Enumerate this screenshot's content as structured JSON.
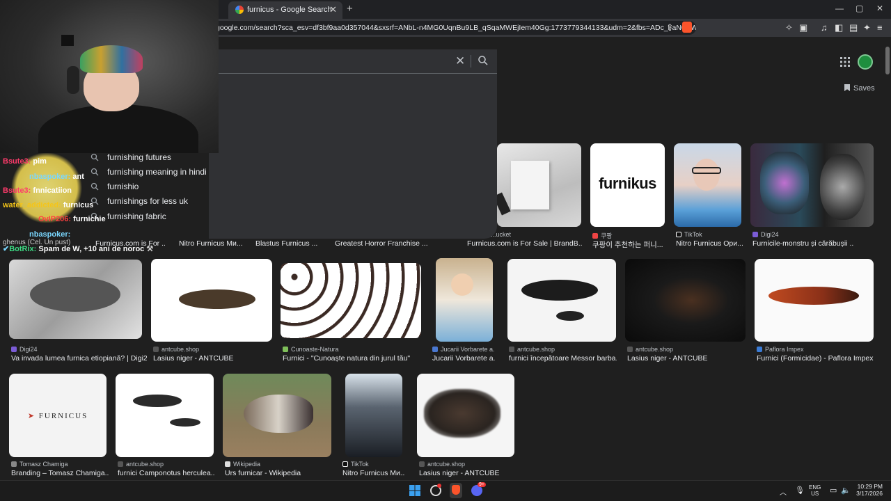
{
  "browser": {
    "tab_title": "furnicus - Google Search",
    "new_tab": "+",
    "close_tab": "✕",
    "url": "google.com/search?sca_esv=df3bf9aa0d357044&sxsrf=ANbL-n4MG0UqnBu9LB_qSqaMWEjIem40Gg:1773779344133&udm=2&fbs=ADc_l-aN0CWEZBOHj...",
    "window_controls": [
      "—",
      "▢",
      "✕"
    ]
  },
  "search": {
    "suggestions": [
      "furnishing futures",
      "furnishing meaning in hindi",
      "furnishio",
      "furnishings for less uk",
      "furnishing fabric"
    ]
  },
  "header": {
    "saves_label": "Saves"
  },
  "results_row1": [
    {
      "source": "",
      "caption": "Furnicus.com is For ..."
    },
    {
      "source": "",
      "caption": "Nitro Furnicus Ми..."
    },
    {
      "source": "",
      "caption": "Blastus Furnicus ..."
    },
    {
      "source": "",
      "caption": "Greatest Horror Franchise ..."
    },
    {
      "source": "...ucket",
      "caption": "Furnicus.com is For Sale | BrandB..."
    },
    {
      "source": "쿠팡",
      "caption": "쿠팡이 추천하는 퍼니..."
    },
    {
      "source": "TikTok",
      "caption": "Nitro Furnicus Ори..."
    },
    {
      "source": "Digi24",
      "caption": "Furnicile-monstru și cărăbușii ..."
    }
  ],
  "furnicus_logo": "furnikus",
  "results_row2": [
    {
      "source": "Digi24",
      "caption": "Va invada lumea furnica etiopiană? | Digi24"
    },
    {
      "source": "antcube.shop",
      "caption": "Lasius niger - ANTCUBE"
    },
    {
      "source": "Cunoaste-Natura",
      "caption": "Furnici - \"Cunoaște natura din jurul tău\""
    },
    {
      "source": "Jucarii Vorbarete a...",
      "caption": "Jucarii Vorbarete a..."
    },
    {
      "source": "antcube.shop",
      "caption": "furnici începătoare Messor barba..."
    },
    {
      "source": "antcube.shop",
      "caption": "Lasius niger - ANTCUBE"
    },
    {
      "source": "Paflora Impex",
      "caption": "Furnici (Formicidae) - Paflora Impex"
    }
  ],
  "results_row3": [
    {
      "source": "Tomasz Chamiga",
      "caption": "Branding – Tomasz Chamiga..."
    },
    {
      "source": "antcube.shop",
      "caption": "furnici Camponotus herculea..."
    },
    {
      "source": "Wikipedia",
      "caption": "Urs furnicar - Wikipedia"
    },
    {
      "source": "TikTok",
      "caption": "Nitro Furnicus Ми..."
    },
    {
      "source": "antcube.shop",
      "caption": "Lasius niger - ANTCUBE"
    }
  ],
  "branding_logo_text": "FURNICUS",
  "chat": [
    {
      "user": "Bsute3:",
      "msg": "pim",
      "color": "#ff3b6b"
    },
    {
      "user": "nbaspoker:",
      "msg": "ant",
      "color": "#7ad7ff"
    },
    {
      "user": "Bsute3:",
      "msg": "fnnicatiion",
      "color": "#ff3b6b"
    },
    {
      "user": "water_addicted:",
      "msg": "furnicus",
      "color": "#f5c518"
    },
    {
      "user": "OvIP206:",
      "msg": "furnichie",
      "color": "#ff4040"
    },
    {
      "user": "nbaspoker:",
      "msg": "ghenus (Cel. Un pust)",
      "color": "#7ad7ff"
    },
    {
      "user": "BotRix:",
      "msg": "Spam de W, +10 ani de noroc",
      "color": "#3ddc84"
    }
  ],
  "taskbar": {
    "lang": "ENG",
    "region": "US",
    "time": "10:29 PM",
    "date": "3/17/2026",
    "discord_badge": "9+"
  }
}
